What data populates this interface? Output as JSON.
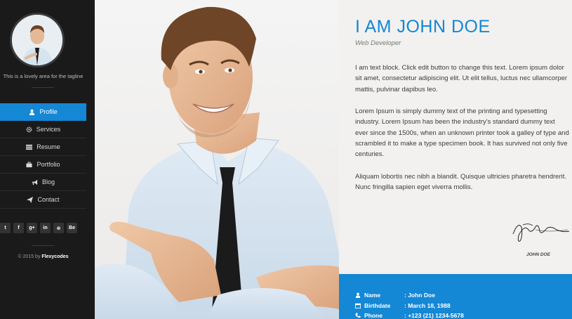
{
  "sidebar": {
    "tagline": "This is a lovely area for the tagline",
    "nav": [
      {
        "label": "Profile",
        "icon": "user-icon",
        "active": true
      },
      {
        "label": "Services",
        "icon": "gear-icon"
      },
      {
        "label": "Resume",
        "icon": "list-icon"
      },
      {
        "label": "Portfolio",
        "icon": "briefcase-icon"
      },
      {
        "label": "Blog",
        "icon": "megaphone-icon"
      },
      {
        "label": "Contact",
        "icon": "paper-plane-icon"
      }
    ],
    "social": [
      "twitter",
      "facebook",
      "google-plus",
      "linkedin",
      "dribbble",
      "behance"
    ],
    "social_glyphs": [
      "t",
      "f",
      "g+",
      "in",
      "⊛",
      "Be"
    ],
    "copyright_prefix": "© 2015 by ",
    "copyright_brand": "Flexycodes"
  },
  "profile": {
    "name": "I AM JOHN DOE",
    "role": "Web Developer",
    "paragraphs": [
      "I am text block. Click edit button to change this text. Lorem ipsum dolor sit amet, consectetur adipiscing elit. Ut elit tellus, luctus nec ullamcorper mattis, pulvinar dapibus leo.",
      "Lorem Ipsum is simply dummy text of the printing and typesetting industry. Lorem Ipsum has been the industry's standard dummy text ever since the 1500s, when an unknown printer took a galley of type and scrambled it to make a type specimen book. It has survived not only five centuries.",
      "Aliquam lobortis nec nibh a blandit. Quisque ultricies pharetra hendrerit. Nunc fringilla sapien eget viverra mollis."
    ],
    "signature_name": "JOHN DOE"
  },
  "info": [
    {
      "label": "Name",
      "value": ": John Doe",
      "icon": "user-icon"
    },
    {
      "label": "Birthdate",
      "value": ": March 18, 1988",
      "icon": "calendar-icon"
    },
    {
      "label": "Phone",
      "value": ": +123 (21) 1234-5678",
      "icon": "phone-icon"
    }
  ],
  "colors": {
    "accent": "#1487d5",
    "sidebar_bg": "#1a1a1a"
  }
}
